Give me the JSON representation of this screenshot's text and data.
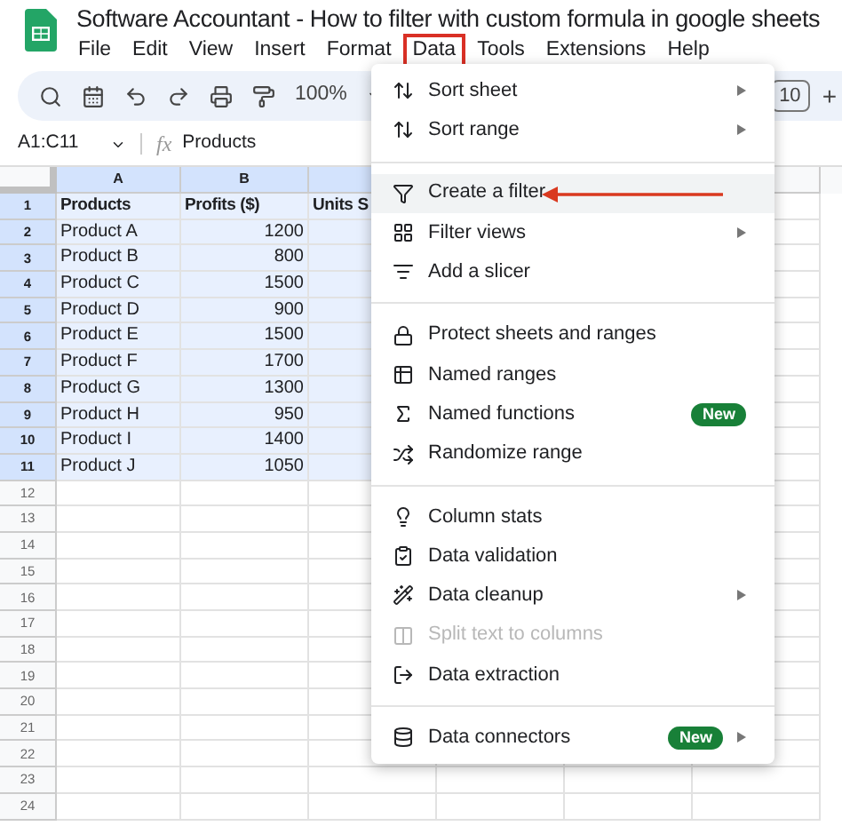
{
  "app": {
    "title": "Software Accountant - How to filter with custom formula in google sheets"
  },
  "menu_bar": [
    {
      "label": "File",
      "selected": false
    },
    {
      "label": "Edit",
      "selected": false
    },
    {
      "label": "View",
      "selected": false
    },
    {
      "label": "Insert",
      "selected": false
    },
    {
      "label": "Format",
      "selected": false
    },
    {
      "label": "Data",
      "selected": true
    },
    {
      "label": "Tools",
      "selected": false
    },
    {
      "label": "Extensions",
      "selected": false
    },
    {
      "label": "Help",
      "selected": false
    }
  ],
  "toolbar": {
    "zoom": "100%",
    "font_size": "10",
    "increase": "+"
  },
  "formula_bar": {
    "cell_ref": "A1:C11",
    "fx": "fx",
    "value": "Products"
  },
  "grid": {
    "columns": [
      {
        "label": "A",
        "selected": true
      },
      {
        "label": "B",
        "selected": true
      },
      {
        "selected": true
      }
    ],
    "rows": [
      {
        "number": "1",
        "kind": "header",
        "selected": true,
        "cells": [
          "Products",
          "Profits ($)",
          "Units S"
        ]
      },
      {
        "number": "2",
        "kind": "data",
        "selected": true,
        "cells": [
          "Product A",
          "1200"
        ]
      },
      {
        "number": "3",
        "kind": "data",
        "selected": true,
        "cells": [
          "Product B",
          "800"
        ]
      },
      {
        "number": "4",
        "kind": "data",
        "selected": true,
        "cells": [
          "Product C",
          "1500"
        ]
      },
      {
        "number": "5",
        "kind": "data",
        "selected": true,
        "cells": [
          "Product D",
          "900"
        ]
      },
      {
        "number": "6",
        "kind": "data",
        "selected": true,
        "cells": [
          "Product E",
          "1500"
        ]
      },
      {
        "number": "7",
        "kind": "data",
        "selected": true,
        "cells": [
          "Product F",
          "1700"
        ]
      },
      {
        "number": "8",
        "kind": "data",
        "selected": true,
        "cells": [
          "Product G",
          "1300"
        ]
      },
      {
        "number": "9",
        "kind": "data",
        "selected": true,
        "cells": [
          "Product H",
          "950"
        ]
      },
      {
        "number": "10",
        "kind": "data",
        "selected": true,
        "cells": [
          "Product I",
          "1400"
        ]
      },
      {
        "number": "11",
        "kind": "data",
        "selected": true,
        "cells": [
          "Product J",
          "1050"
        ]
      },
      {
        "number": "12",
        "kind": "data",
        "selected": false,
        "cells": []
      },
      {
        "number": "13",
        "kind": "data",
        "selected": false,
        "cells": []
      },
      {
        "number": "14",
        "kind": "data",
        "selected": false,
        "cells": []
      },
      {
        "number": "15",
        "kind": "data",
        "selected": false,
        "cells": []
      },
      {
        "number": "16",
        "kind": "data",
        "selected": false,
        "cells": []
      },
      {
        "number": "17",
        "kind": "data",
        "selected": false,
        "cells": []
      },
      {
        "number": "18",
        "kind": "data",
        "selected": false,
        "cells": []
      },
      {
        "number": "19",
        "kind": "data",
        "selected": false,
        "cells": []
      },
      {
        "number": "20",
        "kind": "data",
        "selected": false,
        "cells": []
      },
      {
        "number": "21",
        "kind": "data",
        "selected": false,
        "cells": []
      },
      {
        "number": "22",
        "kind": "data",
        "selected": false,
        "cells": []
      },
      {
        "number": "23",
        "kind": "data",
        "selected": false,
        "cells": []
      },
      {
        "number": "24",
        "kind": "data",
        "selected": false,
        "cells": []
      }
    ]
  },
  "data_menu": [
    {
      "kind": "item",
      "label": "Sort sheet",
      "submenu": true,
      "highlighted": false,
      "disabled": false,
      "pointer": false
    },
    {
      "kind": "item",
      "label": "Sort range",
      "submenu": true,
      "highlighted": false,
      "disabled": false,
      "pointer": false
    },
    {
      "kind": "divider"
    },
    {
      "kind": "item",
      "label": "Create a filter",
      "submenu": false,
      "highlighted": true,
      "disabled": false,
      "pointer": true
    },
    {
      "kind": "item",
      "label": "Filter views",
      "submenu": true,
      "highlighted": false,
      "disabled": false,
      "pointer": false
    },
    {
      "kind": "item",
      "label": "Add a slicer",
      "submenu": false,
      "highlighted": false,
      "disabled": false,
      "pointer": false
    },
    {
      "kind": "divider"
    },
    {
      "kind": "item",
      "label": "Protect sheets and ranges",
      "submenu": false,
      "highlighted": false,
      "disabled": false,
      "pointer": false
    },
    {
      "kind": "item",
      "label": "Named ranges",
      "submenu": false,
      "highlighted": false,
      "disabled": false,
      "pointer": false
    },
    {
      "kind": "item",
      "label": "Named functions",
      "badge": "New",
      "submenu": false,
      "highlighted": false,
      "disabled": false,
      "pointer": false
    },
    {
      "kind": "item",
      "label": "Randomize range",
      "submenu": false,
      "highlighted": false,
      "disabled": false,
      "pointer": false
    },
    {
      "kind": "divider"
    },
    {
      "kind": "item",
      "label": "Column stats",
      "submenu": false,
      "highlighted": false,
      "disabled": false,
      "pointer": false
    },
    {
      "kind": "item",
      "label": "Data validation",
      "submenu": false,
      "highlighted": false,
      "disabled": false,
      "pointer": false
    },
    {
      "kind": "item",
      "label": "Data cleanup",
      "submenu": true,
      "highlighted": false,
      "disabled": false,
      "pointer": false
    },
    {
      "kind": "item",
      "label": "Split text to columns",
      "submenu": false,
      "highlighted": false,
      "disabled": true,
      "pointer": false
    },
    {
      "kind": "item",
      "label": "Data extraction",
      "submenu": false,
      "highlighted": false,
      "disabled": false,
      "pointer": false
    },
    {
      "kind": "divider"
    },
    {
      "kind": "item",
      "label": "Data connectors",
      "badge": "New",
      "submenu": true,
      "highlighted": false,
      "disabled": false,
      "pointer": false
    }
  ]
}
